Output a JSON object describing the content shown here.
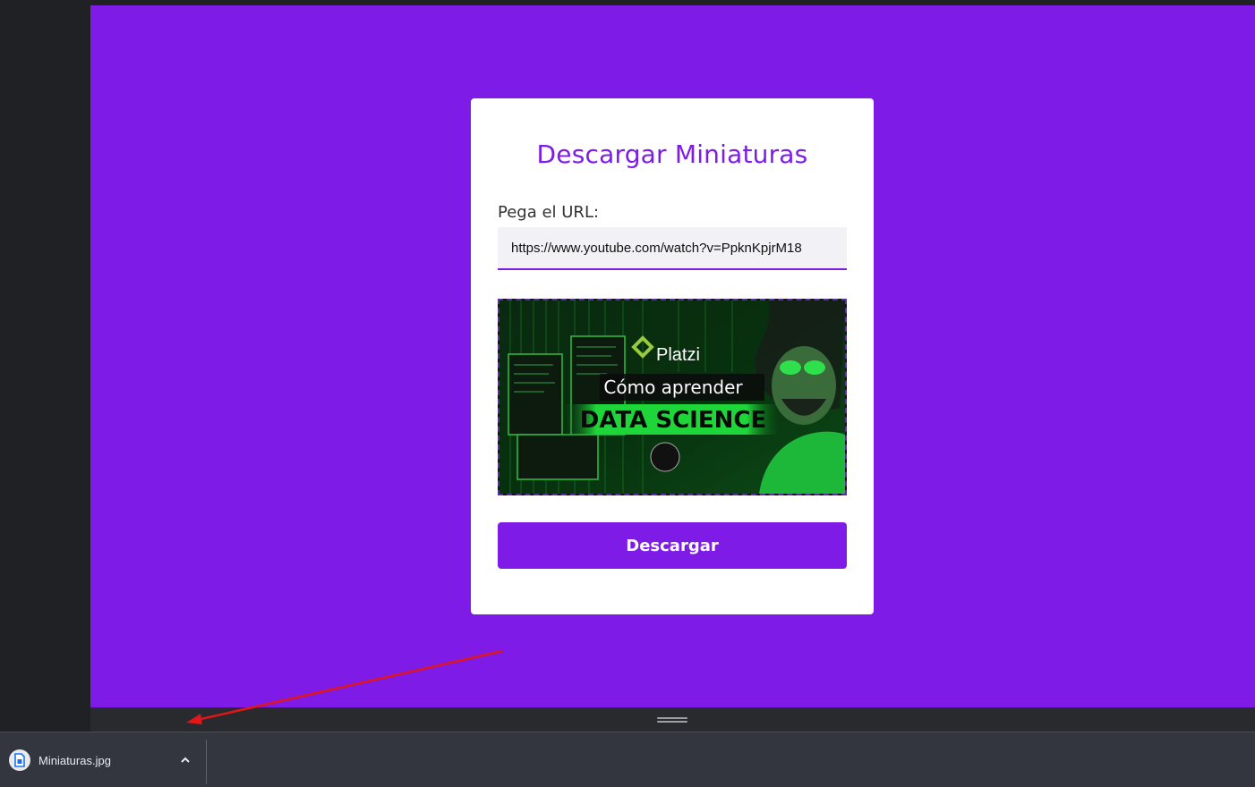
{
  "app": {
    "title": "Descargar Miniaturas",
    "url_label": "Pega el URL:",
    "url_value": "https://www.youtube.com/watch?v=PpknKpjrM18",
    "button_label": "Descargar"
  },
  "thumbnail": {
    "brand": "Platzi",
    "headline": "Cómo aprender",
    "subject": "DATA SCIENCE"
  },
  "download_shelf": {
    "file_name": "Miniaturas.jpg",
    "icon": "file-icon"
  },
  "colors": {
    "accent": "#7e1be6",
    "thumbnail_green": "#1fd63a",
    "shelf_bg": "#33363f",
    "arrow": "#e0161b"
  }
}
